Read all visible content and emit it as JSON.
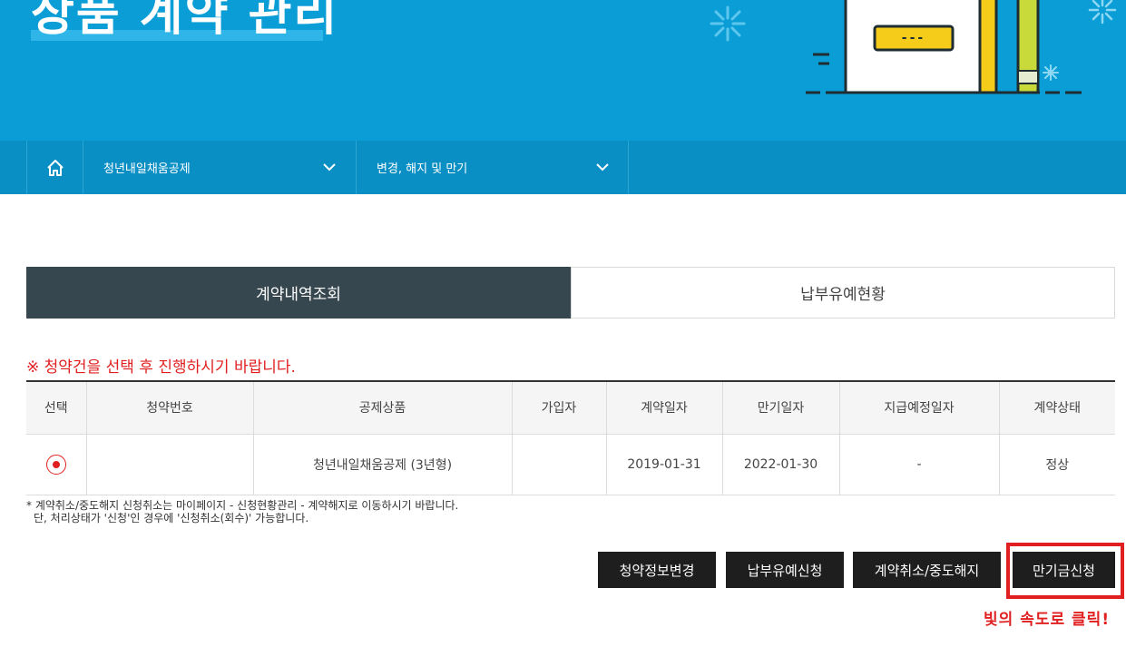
{
  "hero": {
    "title": "상품 계약 관리",
    "art_label": "---"
  },
  "nav": {
    "home_icon": "home-icon",
    "dropdown1": "청년내일채움공제",
    "dropdown2": "변경, 해지 및 만기"
  },
  "tabs": [
    {
      "label": "계약내역조회",
      "active": true
    },
    {
      "label": "납부유예현황",
      "active": false
    }
  ],
  "notice": "※ 청약건을 선택 후 진행하시기 바랍니다.",
  "table": {
    "headers": [
      "선택",
      "청약번호",
      "공제상품",
      "가입자",
      "계약일자",
      "만기일자",
      "지급예정일자",
      "계약상태"
    ],
    "rows": [
      {
        "selected": true,
        "contract_no": "",
        "product": "청년내일채움공제 (3년형)",
        "subscriber": "",
        "contract_date": "2019-01-31",
        "maturity_date": "2022-01-30",
        "payment_date": "-",
        "status": "정상"
      }
    ]
  },
  "footnote": {
    "line1": "* 계약취소/중도해지 신청취소는 마이페이지 - 신청현황관리 - 계약해지로 이동하시기 바랍니다.",
    "line2": "단, 처리상태가 '신청'인 경우에 '신청취소(회수)' 가능합니다."
  },
  "buttons": {
    "change_info": "청약정보변경",
    "defer_payment": "납부유예신청",
    "cancel_terminate": "계약취소/중도해지",
    "maturity_apply": "만기금신청"
  },
  "annotation": "빛의 속도로 클릭!",
  "colors": {
    "hero_bg": "#0b9ed6",
    "nav_bg": "#0a8fc4",
    "tab_active": "#37474f",
    "accent_red": "#e02020",
    "button_bg": "#1e1e1e"
  }
}
